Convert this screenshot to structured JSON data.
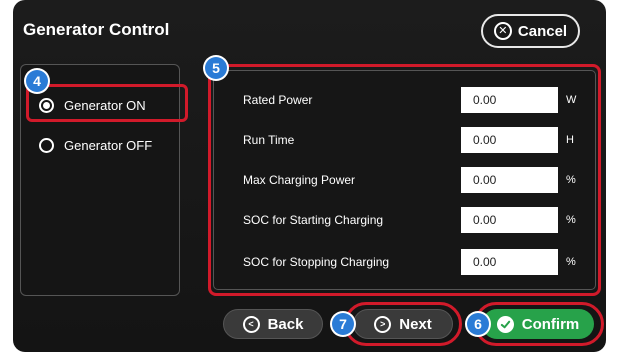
{
  "title": "Generator Control",
  "cancel_label": "Cancel",
  "options": [
    {
      "label": "Generator ON",
      "checked": true
    },
    {
      "label": "Generator OFF",
      "checked": false
    }
  ],
  "fields": [
    {
      "label": "Rated Power",
      "value": "0.00",
      "unit": "W"
    },
    {
      "label": "Run Time",
      "value": "0.00",
      "unit": "H"
    },
    {
      "label": "Max Charging Power",
      "value": "0.00",
      "unit": "%"
    },
    {
      "label": "SOC for Starting Charging",
      "value": "0.00",
      "unit": "%"
    },
    {
      "label": "SOC for Stopping Charging",
      "value": "0.00",
      "unit": "%"
    }
  ],
  "buttons": {
    "back": "Back",
    "next": "Next",
    "confirm": "Confirm"
  },
  "callouts": {
    "radio": "4",
    "fields": "5",
    "confirm": "6",
    "next": "7"
  },
  "colors": {
    "highlight": "#d11a2a",
    "badge": "#2a7bd6",
    "confirm": "#27a24a",
    "background": "#1a1a1a"
  }
}
